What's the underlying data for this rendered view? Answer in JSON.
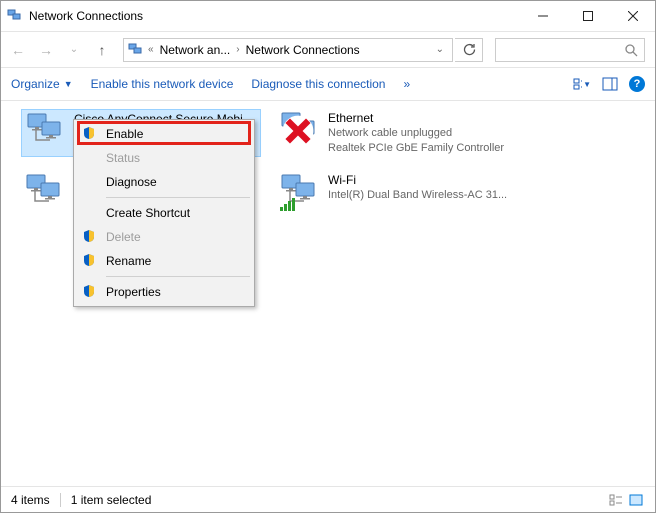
{
  "window": {
    "title": "Network Connections"
  },
  "breadcrumb": {
    "seg1": "Network an...",
    "seg2": "Network Connections"
  },
  "commands": {
    "organize": "Organize",
    "enable": "Enable this network device",
    "diagnose": "Diagnose this connection",
    "more": "»"
  },
  "adapters": [
    {
      "name": "Cisco AnyConnect Secure Mobility",
      "l2": "",
      "l3": "",
      "selected": true
    },
    {
      "name": "Ethernet",
      "l2": "Network cable unplugged",
      "l3": "Realtek PCIe GbE Family Controller",
      "status": "unplugged"
    },
    {
      "name": "",
      "l2": "",
      "l3": ""
    },
    {
      "name": "Wi-Fi",
      "l2": "",
      "l3": "Intel(R) Dual Band Wireless-AC 31...",
      "status": "wifi"
    }
  ],
  "context_menu": {
    "enable": "Enable",
    "status": "Status",
    "diagnose": "Diagnose",
    "create_shortcut": "Create Shortcut",
    "delete": "Delete",
    "rename": "Rename",
    "properties": "Properties"
  },
  "status": {
    "count": "4 items",
    "selected": "1 item selected"
  }
}
